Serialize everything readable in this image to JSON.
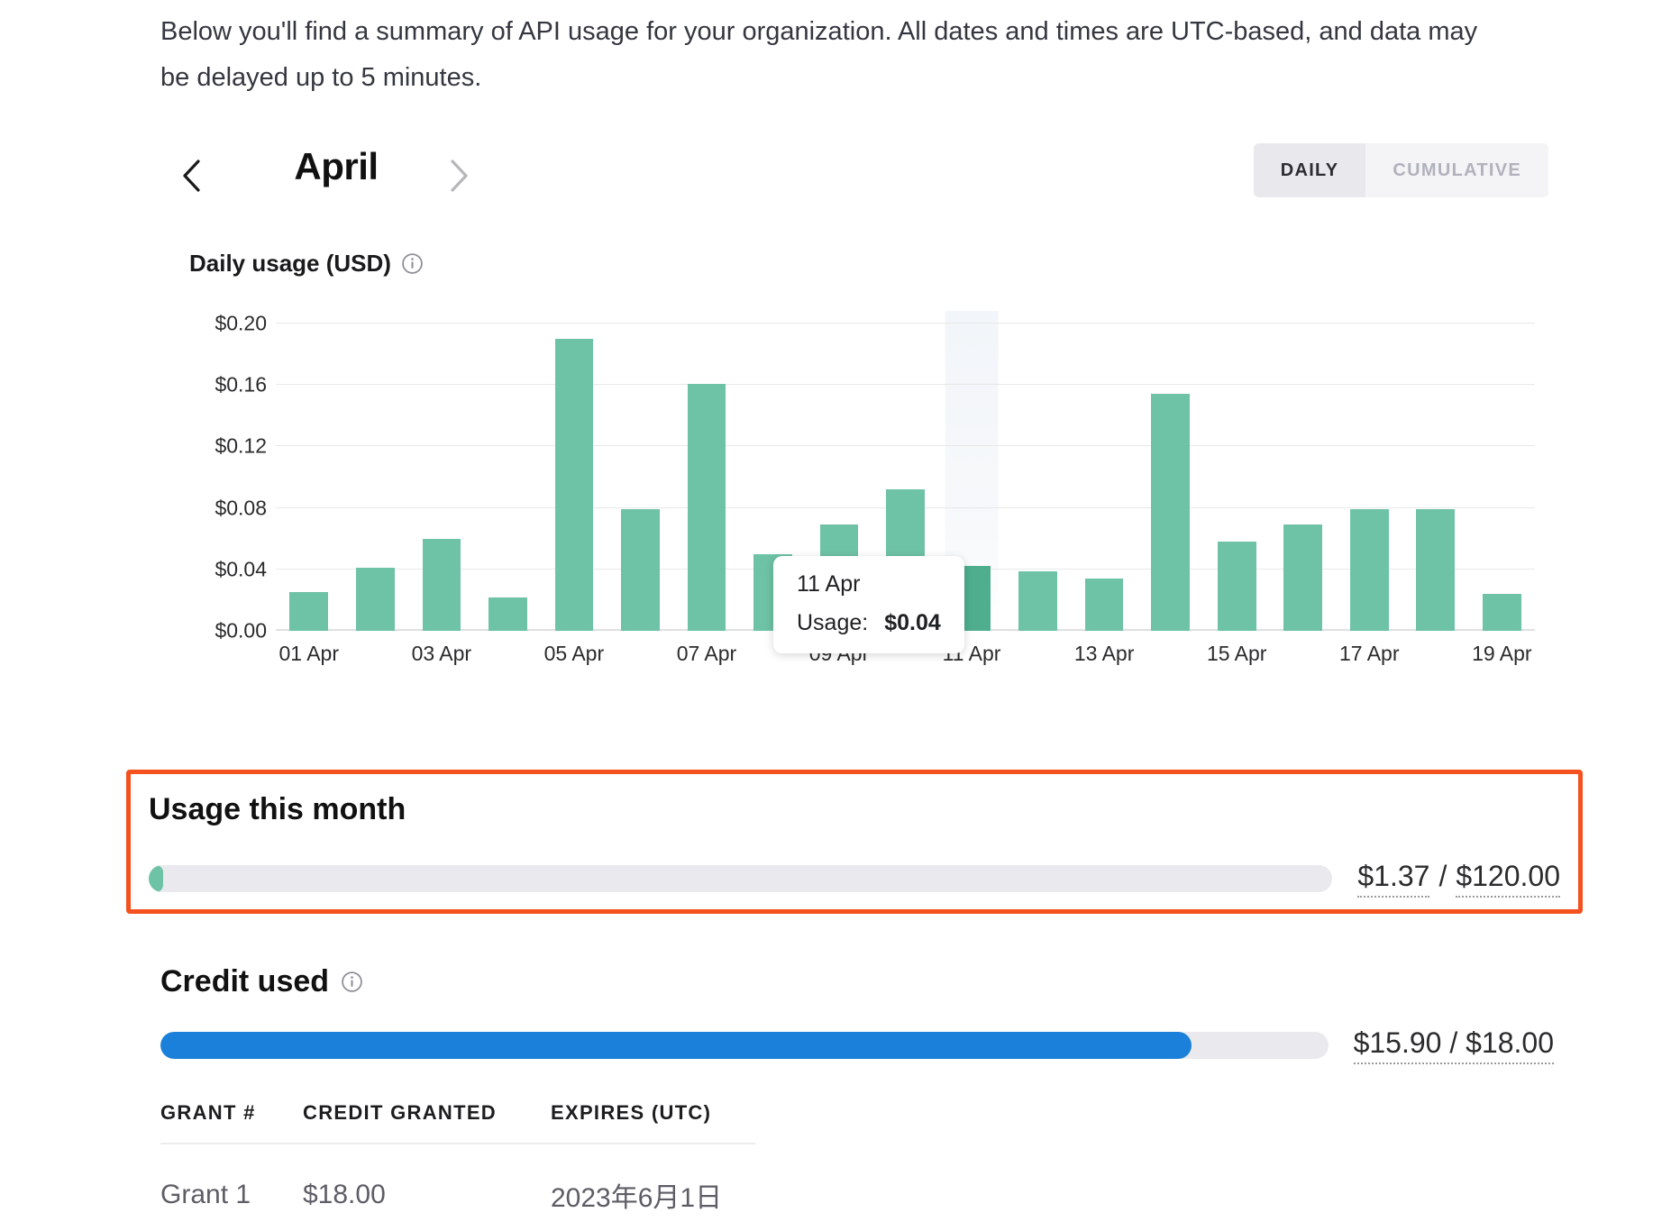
{
  "intro": {
    "text": "Below you'll find a summary of API usage for your organization. All dates and times are UTC-based, and data may be delayed up to 5 minutes."
  },
  "month_nav": {
    "prev_label": "‹",
    "month": "April",
    "next_label": "›",
    "next_disabled": true
  },
  "view_toggle": {
    "daily_label": "DAILY",
    "cumulative_label": "CUMULATIVE",
    "active": "DAILY"
  },
  "chart_header": {
    "title": "Daily usage (USD)",
    "info_icon": "info-icon"
  },
  "tooltip": {
    "date": "11 Apr",
    "usage_label": "Usage:",
    "usage_value": "$0.04"
  },
  "usage_this_month": {
    "title": "Usage this month",
    "used": "$1.37",
    "separator": "/",
    "limit": "$120.00",
    "percent": 1.14,
    "bar_color": "#6ec2a5",
    "highlight_border_color": "#f4511e"
  },
  "credit_used": {
    "title": "Credit used",
    "info_icon": "info-icon",
    "used": "$15.90",
    "separator": "/",
    "limit": "$18.00",
    "combined_label": "$15.90 / $18.00",
    "percent": 88.3,
    "bar_color": "#1a80d9"
  },
  "grants": {
    "columns": [
      "GRANT #",
      "CREDIT GRANTED",
      "EXPIRES (UTC)"
    ],
    "rows": [
      {
        "grant": "Grant 1",
        "credit": "$18.00",
        "expires": "2023年6月1日"
      }
    ]
  },
  "chart_data": {
    "type": "bar",
    "title": "Daily usage (USD)",
    "xlabel": "",
    "ylabel": "USD",
    "ylim": [
      0.0,
      0.2
    ],
    "yticks": [
      "$0.00",
      "$0.04",
      "$0.08",
      "$0.12",
      "$0.16",
      "$0.20"
    ],
    "ytick_values": [
      0.0,
      0.04,
      0.08,
      0.12,
      0.16,
      0.2
    ],
    "grid": true,
    "legend": "none",
    "bar_color": "#6ec2a5",
    "highlight_color": "#4fae8e",
    "highlighted_index": 10,
    "categories": [
      "01 Apr",
      "02 Apr",
      "03 Apr",
      "04 Apr",
      "05 Apr",
      "06 Apr",
      "07 Apr",
      "08 Apr",
      "09 Apr",
      "10 Apr",
      "11 Apr",
      "12 Apr",
      "13 Apr",
      "14 Apr",
      "15 Apr",
      "16 Apr",
      "17 Apr",
      "18 Apr",
      "19 Apr"
    ],
    "xtick_labels": [
      "01 Apr",
      "03 Apr",
      "05 Apr",
      "07 Apr",
      "09 Apr",
      "11 Apr",
      "13 Apr",
      "15 Apr",
      "17 Apr",
      "19 Apr"
    ],
    "values": [
      0.025,
      0.041,
      0.06,
      0.022,
      0.19,
      0.079,
      0.161,
      0.05,
      0.069,
      0.092,
      0.042,
      0.039,
      0.034,
      0.154,
      0.058,
      0.069,
      0.079,
      0.079,
      0.024
    ],
    "annotations": [
      {
        "x": "11 Apr",
        "label": "11 Apr",
        "value": "$0.04"
      }
    ]
  }
}
